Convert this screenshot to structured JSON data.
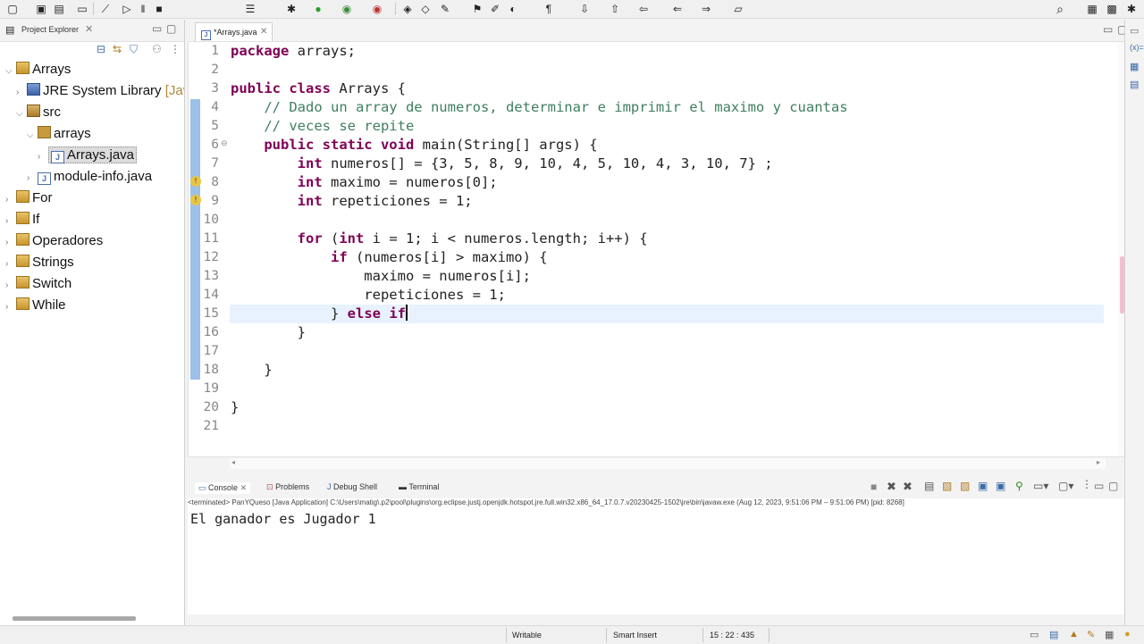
{
  "toolbar": {
    "search_icon": "search-icon"
  },
  "explorer": {
    "title": "Project Explorer",
    "tree": [
      {
        "label": "Arrays",
        "icon": "project-icon",
        "depth": 0,
        "expanded": true
      },
      {
        "label": "JRE System Library",
        "suffix": "[Jav",
        "icon": "library-icon",
        "depth": 1,
        "expanded": false
      },
      {
        "label": "src",
        "icon": "source-folder-icon",
        "depth": 1,
        "expanded": true
      },
      {
        "label": "arrays",
        "icon": "package-icon",
        "depth": 2,
        "expanded": true
      },
      {
        "label": "Arrays.java",
        "icon": "java-file-icon",
        "depth": 3,
        "expanded": false,
        "selected": true
      },
      {
        "label": "module-info.java",
        "icon": "java-file-icon",
        "depth": 2,
        "expanded": false
      },
      {
        "label": "For",
        "icon": "project-icon",
        "depth": 0,
        "expanded": false
      },
      {
        "label": "If",
        "icon": "project-icon",
        "depth": 0,
        "expanded": false
      },
      {
        "label": "Operadores",
        "icon": "project-icon",
        "depth": 0,
        "expanded": false
      },
      {
        "label": "Strings",
        "icon": "project-icon",
        "depth": 0,
        "expanded": false
      },
      {
        "label": "Switch",
        "icon": "project-icon",
        "depth": 0,
        "expanded": false
      },
      {
        "label": "While",
        "icon": "project-icon",
        "depth": 0,
        "expanded": false
      }
    ]
  },
  "editor": {
    "tab_label": "*Arrays.java",
    "lines": [
      "1",
      "2",
      "3",
      "4",
      "5",
      "6",
      "7",
      "8",
      "9",
      "10",
      "11",
      "12",
      "13",
      "14",
      "15",
      "16",
      "17",
      "18",
      "19",
      "20",
      "21"
    ],
    "code": {
      "l1_kw": "package",
      "l1_rest": " arrays;",
      "l3_kw": "public class",
      "l3_rest": " Arrays {",
      "l4": "    // Dado un array de numeros, determinar e imprimir el maximo y cuantas",
      "l5": "    // veces se repite",
      "l6_kw": "    public static void",
      "l6_rest": " main(String[] args) {",
      "l7_kw": "        int",
      "l7_rest": " numeros[] = {3, 5, 8, 9, 10, 4, 5, 10, 4, 3, 10, 7} ;",
      "l8_kw": "        int",
      "l8_rest": " maximo = numeros[0];",
      "l9_kw": "        int",
      "l9_rest": " repeticiones = 1;",
      "l11_kw1": "        for",
      "l11_mid": " (",
      "l11_kw2": "int",
      "l11_rest": " i = 1; i < numeros.length; i++) {",
      "l12_kw": "            if",
      "l12_rest": " (numeros[i] > maximo) {",
      "l13": "                maximo = numeros[i];",
      "l14": "                repeticiones = 1;",
      "l15_pre": "            } ",
      "l15_kw": "else if",
      "l16": "        }",
      "l18": "    }",
      "l20": "}"
    }
  },
  "console": {
    "tabs": [
      "Console",
      "Problems",
      "Debug Shell",
      "Terminal"
    ],
    "info": "<terminated> PanYQueso [Java Application] C:\\Users\\matig\\.p2\\pool\\plugins\\org.eclipse.justj.openjdk.hotspot.jre.full.win32.x86_64_17.0.7.v20230425-1502\\jre\\bin\\javaw.exe  (Aug 12, 2023, 9:51:06 PM – 9:51:06 PM) [pid: 8268]",
    "output": "El ganador es Jugador 1"
  },
  "status": {
    "writable": "Writable",
    "insert_mode": "Smart Insert",
    "position": "15 : 22 : 435"
  },
  "colors": {
    "keyword": "#7f0055",
    "comment": "#3f7f5f",
    "current_line": "#e8f2fe"
  }
}
